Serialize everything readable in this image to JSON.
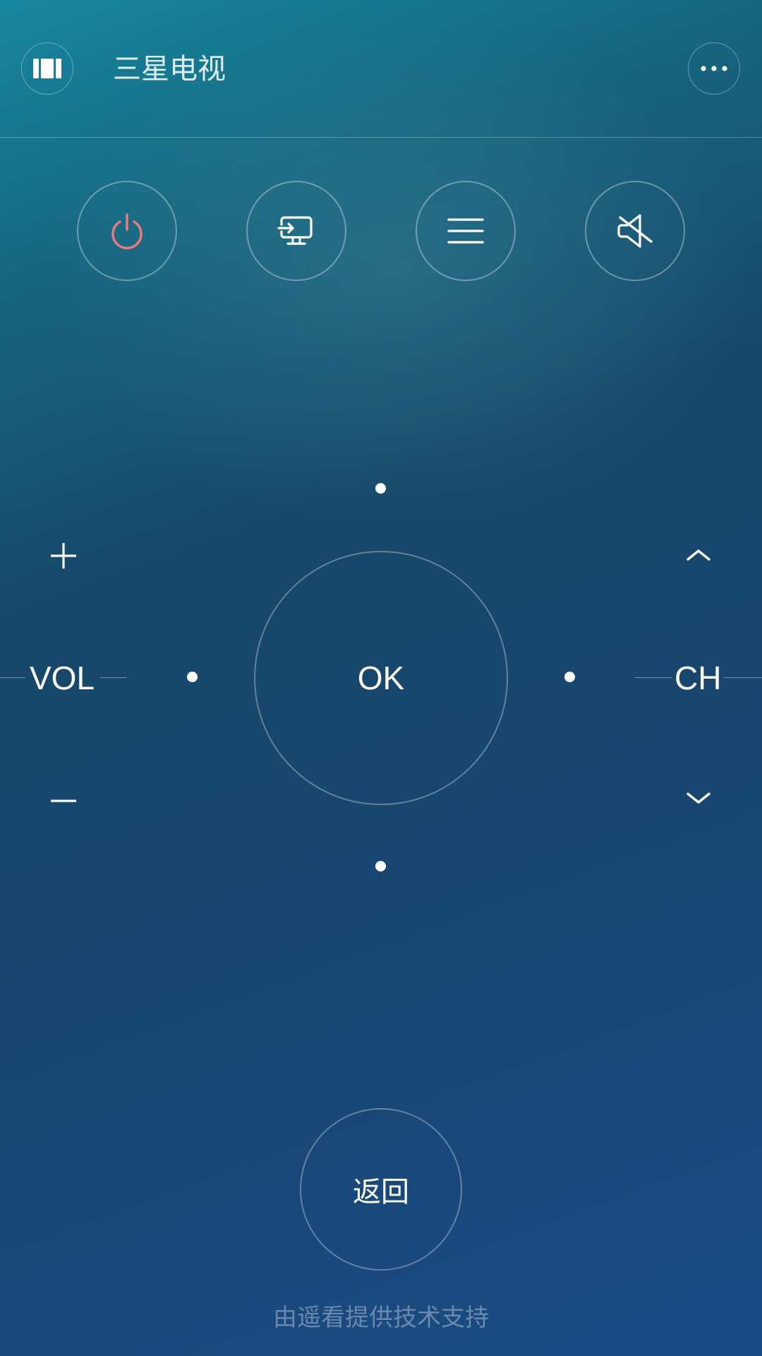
{
  "header": {
    "title": "三星电视",
    "left_icon": "remote-grid-icon",
    "right_icon": "more-dots-icon"
  },
  "controls": [
    {
      "name": "power-button",
      "icon": "power-icon",
      "color": "#e67a80"
    },
    {
      "name": "source-button",
      "icon": "input-source-icon"
    },
    {
      "name": "menu-button",
      "icon": "menu-lines-icon"
    },
    {
      "name": "mute-button",
      "icon": "mute-icon"
    }
  ],
  "dpad": {
    "ok_label": "OK"
  },
  "volume": {
    "label": "VOL",
    "plus_icon": "plus-icon",
    "minus_icon": "minus-icon"
  },
  "channel": {
    "label": "CH",
    "up_icon": "chevron-up-icon",
    "down_icon": "chevron-down-icon"
  },
  "back": {
    "label": "返回"
  },
  "footer": {
    "text": "由遥看提供技术支持"
  },
  "colors": {
    "accent_power": "#e67a80",
    "background_top": "#17879f",
    "background_bottom": "#1a4b86"
  }
}
